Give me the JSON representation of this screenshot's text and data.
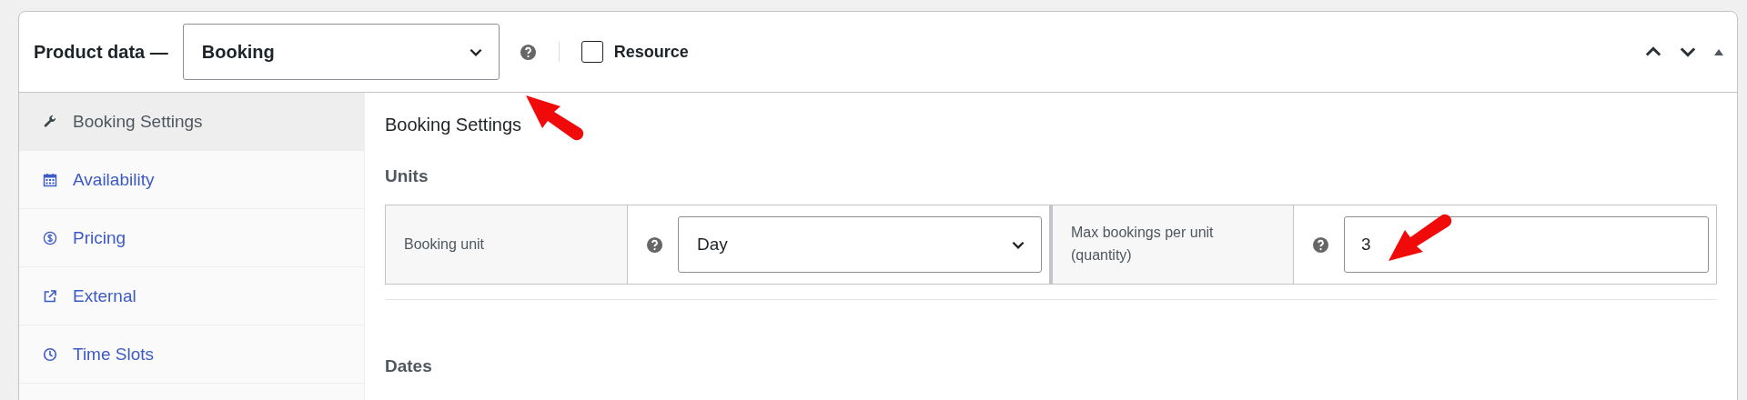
{
  "header": {
    "title": "Product data —",
    "product_type": {
      "value": "Booking"
    },
    "resource": {
      "label": "Resource",
      "checked": false
    }
  },
  "sidebar": {
    "items": [
      {
        "label": "Booking Settings",
        "selected": true
      },
      {
        "label": "Availability",
        "selected": false
      },
      {
        "label": "Pricing",
        "selected": false
      },
      {
        "label": "External",
        "selected": false
      },
      {
        "label": "Time Slots",
        "selected": false
      }
    ]
  },
  "content": {
    "heading": "Booking Settings",
    "units": {
      "title": "Units",
      "booking_unit": {
        "label": "Booking unit",
        "value": "Day"
      },
      "max_bookings": {
        "label": "Max bookings per unit (quantity)",
        "value": "3"
      }
    },
    "dates": {
      "title": "Dates"
    }
  }
}
